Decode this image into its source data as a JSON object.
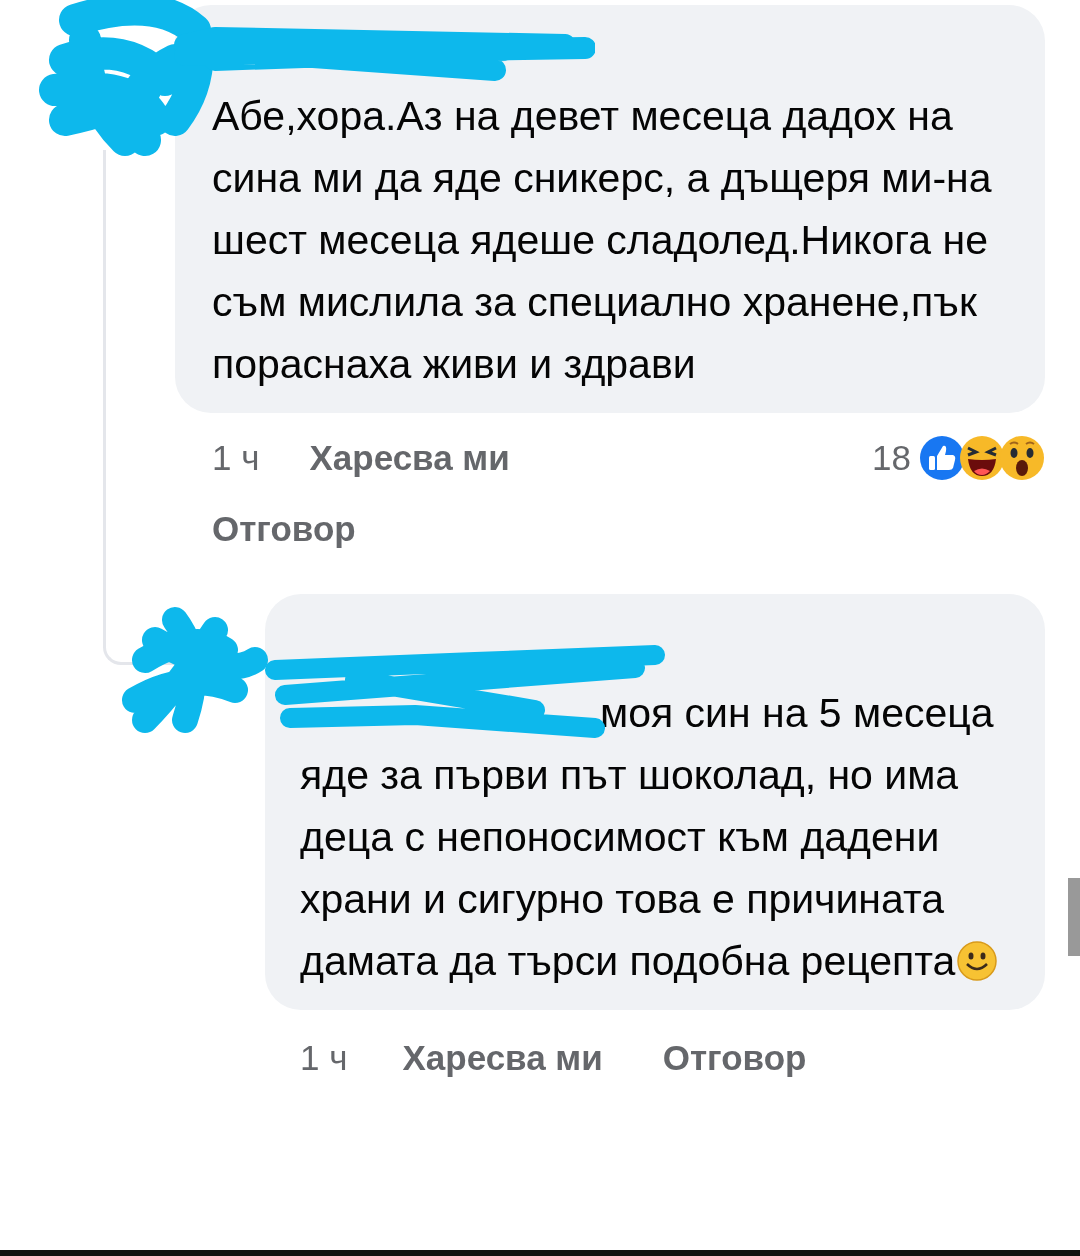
{
  "comment": {
    "body": "Абе,хора.Аз на девет месеца дадох на сина ми да яде сникерс, а дъщеря ми-на шест месеца ядеше сладолед.Никога не съм мислила за специално хранене,пък пораснаха живи и здрави",
    "time": "1 ч",
    "like": "Харесва ми",
    "reply": "Отговор",
    "reaction_count": "18"
  },
  "reply": {
    "body": "моя син на 5 месеца яде за първи път шоколад, но има деца с непоносимост към дадени храни и сигурно това е причината дамата да търси подобна рецепта",
    "time": "1 ч",
    "like": "Харесва ми",
    "reply": "Отговор"
  }
}
